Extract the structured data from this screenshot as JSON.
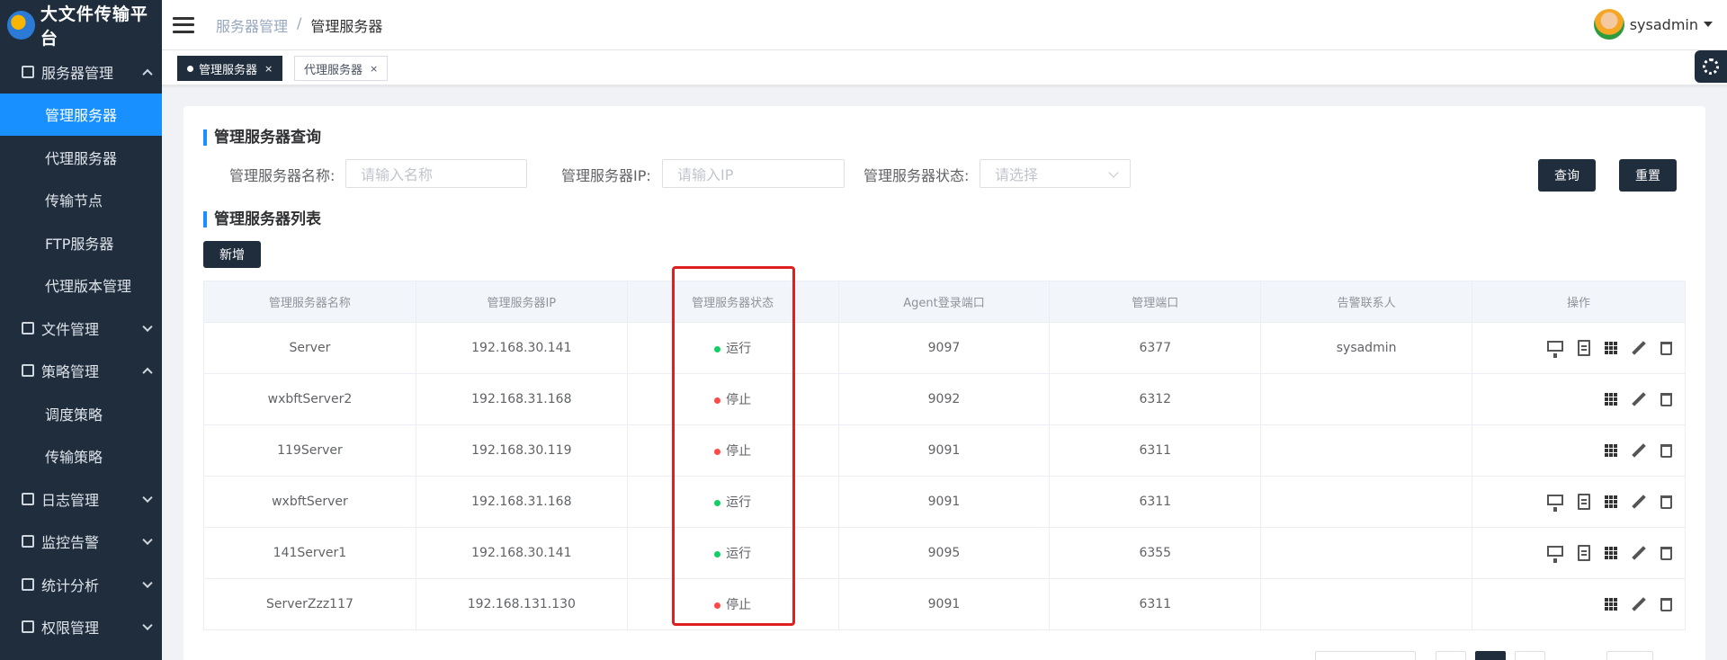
{
  "brand": {
    "title": "大文件传输平台"
  },
  "header": {
    "breadcrumb": [
      "服务器管理",
      "管理服务器"
    ],
    "user": "sysadmin"
  },
  "sidebar": {
    "groups": [
      {
        "label": "服务器管理",
        "expanded": true,
        "children": [
          "管理服务器",
          "代理服务器",
          "传输节点",
          "FTP服务器",
          "代理版本管理"
        ]
      },
      {
        "label": "文件管理",
        "expanded": false
      },
      {
        "label": "策略管理",
        "expanded": true,
        "children": [
          "调度策略",
          "传输策略"
        ]
      },
      {
        "label": "日志管理",
        "expanded": false
      },
      {
        "label": "监控告警",
        "expanded": false
      },
      {
        "label": "统计分析",
        "expanded": false
      },
      {
        "label": "权限管理",
        "expanded": false
      }
    ],
    "active": "管理服务器"
  },
  "tabs": [
    {
      "label": "管理服务器",
      "close": "×",
      "active": true
    },
    {
      "label": "代理服务器",
      "close": "×",
      "active": false
    }
  ],
  "query": {
    "title": "管理服务器查询",
    "name_label": "管理服务器名称:",
    "name_placeholder": "请输入名称",
    "ip_label": "管理服务器IP:",
    "ip_placeholder": "请输入IP",
    "status_label": "管理服务器状态:",
    "status_placeholder": "请选择",
    "search_button": "查询",
    "reset_button": "重置"
  },
  "list": {
    "title": "管理服务器列表",
    "add_button": "新增",
    "columns": [
      "管理服务器名称",
      "管理服务器IP",
      "管理服务器状态",
      "Agent登录端口",
      "管理端口",
      "告警联系人",
      "操作"
    ],
    "rows": [
      {
        "name": "Server",
        "ip": "192.168.30.141",
        "status": "运行",
        "agent_port": "9097",
        "mgmt_port": "6377",
        "contact": "sysadmin",
        "full_ops": true
      },
      {
        "name": "wxbftServer2",
        "ip": "192.168.31.168",
        "status": "停止",
        "agent_port": "9092",
        "mgmt_port": "6312",
        "contact": "",
        "full_ops": false
      },
      {
        "name": "119Server",
        "ip": "192.168.30.119",
        "status": "停止",
        "agent_port": "9091",
        "mgmt_port": "6311",
        "contact": "",
        "full_ops": false
      },
      {
        "name": "wxbftServer",
        "ip": "192.168.31.168",
        "status": "运行",
        "agent_port": "9091",
        "mgmt_port": "6311",
        "contact": "",
        "full_ops": true
      },
      {
        "name": "141Server1",
        "ip": "192.168.30.141",
        "status": "运行",
        "agent_port": "9095",
        "mgmt_port": "6355",
        "contact": "",
        "full_ops": true
      },
      {
        "name": "ServerZzz117",
        "ip": "192.168.131.130",
        "status": "停止",
        "agent_port": "9091",
        "mgmt_port": "6311",
        "contact": "",
        "full_ops": false
      }
    ]
  },
  "colors": {
    "sidebar_bg": "#1f2d3d",
    "active": "#1890ff",
    "running": "#13ce66",
    "stopped": "#ff4949",
    "highlight": "#e02020"
  }
}
